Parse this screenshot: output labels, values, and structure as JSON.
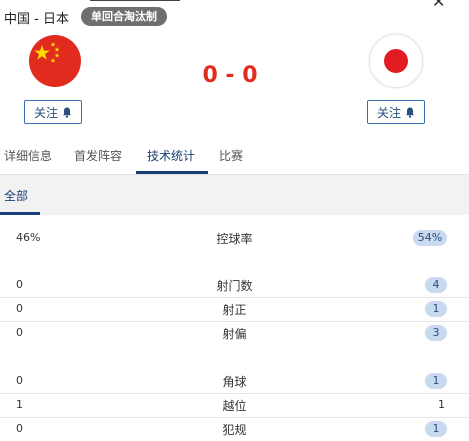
{
  "header": {
    "title": "中国 - 日本",
    "badge": "单回合淘汰制",
    "score": "0 - 0",
    "close_symbol": "✕"
  },
  "home_team": {
    "name": "中国",
    "follow_label": "关注"
  },
  "away_team": {
    "name": "日本",
    "follow_label": "关注"
  },
  "tabs": [
    {
      "label": "详细信息"
    },
    {
      "label": "首发阵容"
    },
    {
      "label": "技术统计",
      "active": true
    },
    {
      "label": "比赛"
    }
  ],
  "subtabs": [
    {
      "label": "全部",
      "active": true
    }
  ],
  "stats": [
    {
      "label": "控球率",
      "home": "46%",
      "away": "54%"
    },
    {
      "label": "射门数",
      "home": "0",
      "away": "4"
    },
    {
      "label": "射正",
      "home": "0",
      "away": "1"
    },
    {
      "label": "射偏",
      "home": "0",
      "away": "3"
    },
    {
      "label": "角球",
      "home": "0",
      "away": "1"
    },
    {
      "label": "越位",
      "home": "1",
      "away": "1"
    },
    {
      "label": "犯规",
      "home": "0",
      "away": "1"
    }
  ],
  "colors": {
    "accent": "#1a3e73",
    "score": "#e12b1f",
    "pill": "#c9daf0"
  }
}
